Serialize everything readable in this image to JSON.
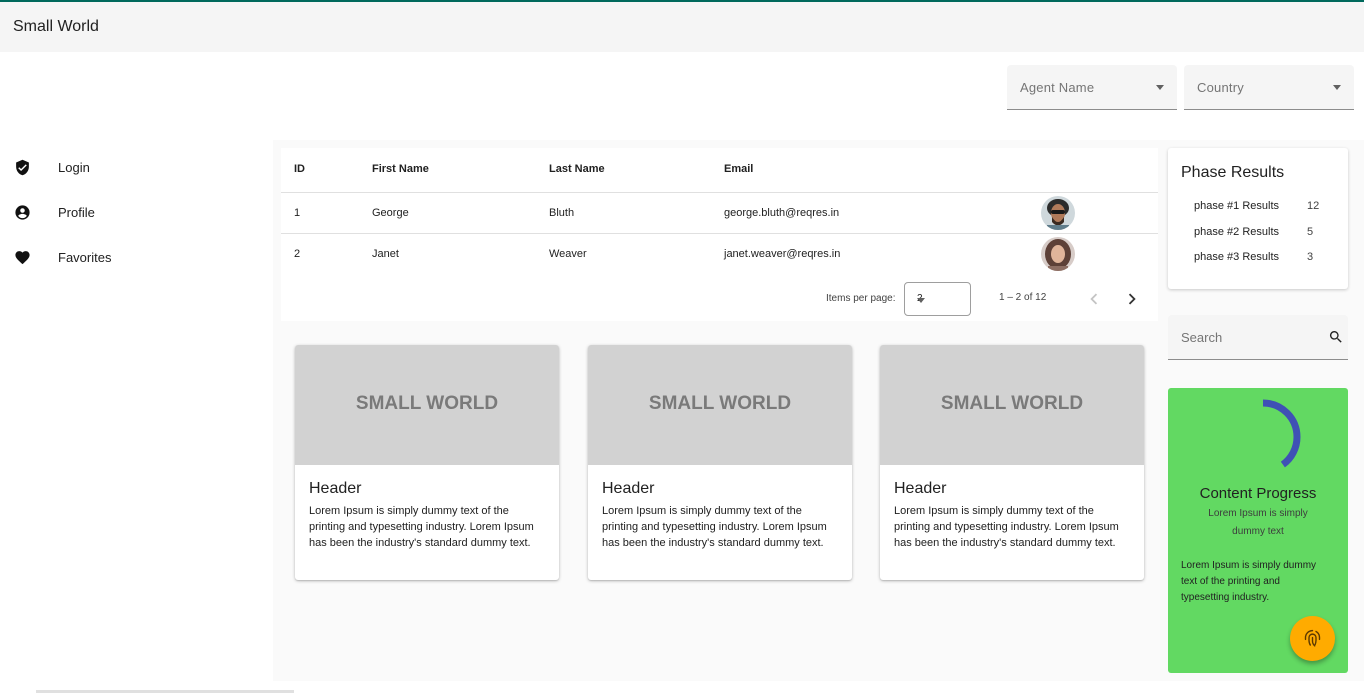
{
  "app": {
    "title": "Small World"
  },
  "filters": {
    "agent_name": "Agent Name",
    "country": "Country"
  },
  "sidebar": {
    "items": [
      {
        "label": "Login",
        "icon": "verified-shield-icon"
      },
      {
        "label": "Profile",
        "icon": "account-circle-icon"
      },
      {
        "label": "Favorites",
        "icon": "heart-icon"
      }
    ]
  },
  "table": {
    "headers": {
      "id": "ID",
      "first_name": "First Name",
      "last_name": "Last Name",
      "email": "Email"
    },
    "rows": [
      {
        "id": "1",
        "first_name": "George",
        "last_name": "Bluth",
        "email": "george.bluth@reqres.in"
      },
      {
        "id": "2",
        "first_name": "Janet",
        "last_name": "Weaver",
        "email": "janet.weaver@reqres.in"
      }
    ],
    "paginator": {
      "items_per_page_label": "Items per page:",
      "page_size": "2",
      "range": "1 – 2 of 12"
    }
  },
  "cards": [
    {
      "image_text": "SMALL WORLD",
      "header": "Header",
      "text": "Lorem Ipsum is simply dummy text of the printing and typesetting industry. Lorem Ipsum has been the industry's standard dummy text."
    },
    {
      "image_text": "SMALL WORLD",
      "header": "Header",
      "text": "Lorem Ipsum is simply dummy text of the printing and typesetting industry. Lorem Ipsum has been the industry's standard dummy text."
    },
    {
      "image_text": "SMALL WORLD",
      "header": "Header",
      "text": "Lorem Ipsum is simply dummy text of the printing and typesetting industry. Lorem Ipsum has been the industry's standard dummy text."
    }
  ],
  "phase_results": {
    "title": "Phase Results",
    "items": [
      {
        "label": "phase #1 Results",
        "count": "12"
      },
      {
        "label": "phase #2 Results",
        "count": "5"
      },
      {
        "label": "phase #3 Results",
        "count": "3"
      }
    ]
  },
  "search": {
    "placeholder": "Search"
  },
  "content_progress": {
    "title": "Content Progress",
    "subtitle": "Lorem Ipsum is simply dummy text",
    "body": "Lorem Ipsum is simply dummy text of the printing and typesetting industry.",
    "progress_fraction": 0.4,
    "ring_color": "#3f51b5",
    "card_color": "#62d962"
  },
  "fab": {
    "icon": "fingerprint-icon",
    "color": "#ffab00"
  }
}
